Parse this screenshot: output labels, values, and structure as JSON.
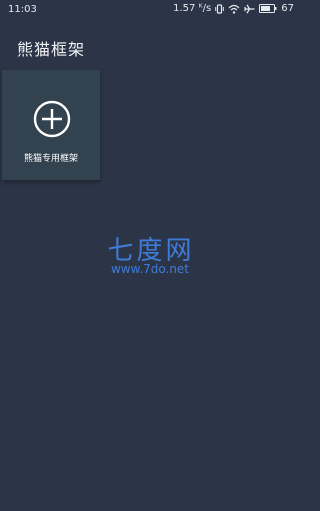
{
  "status_bar": {
    "time": "11:03",
    "network_speed": "1.57 ᴷ/s",
    "battery_level": "67",
    "icons": [
      "vibrate-icon",
      "wifi-icon",
      "airplane-icon",
      "battery-icon"
    ]
  },
  "app": {
    "title": "熊猫框架"
  },
  "tiles": [
    {
      "label": "熊猫专用框架",
      "icon": "add-circle-icon"
    }
  ],
  "watermark": {
    "name": "七度网",
    "url": "www.7do.net",
    "color": "#3f7bd8"
  },
  "colors": {
    "background": "#2b3547",
    "tile": "#33424f"
  }
}
